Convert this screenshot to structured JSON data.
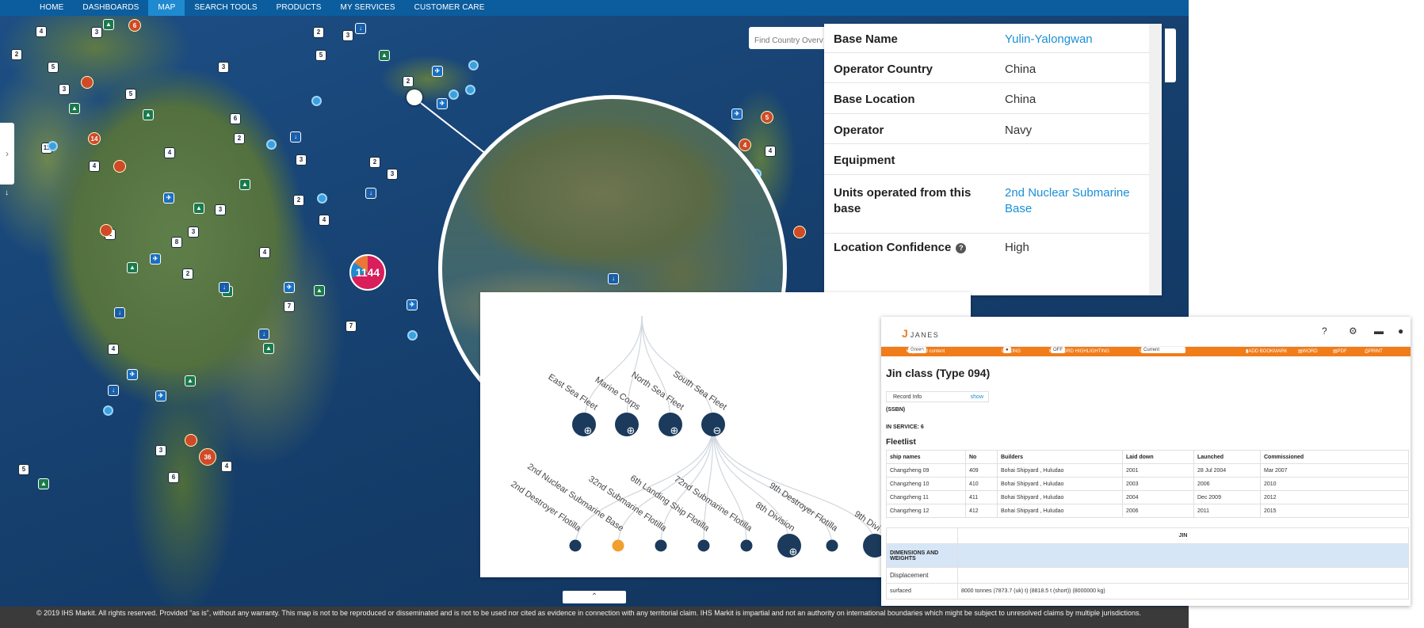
{
  "nav": {
    "items": [
      "HOME",
      "DASHBOARDS",
      "MAP",
      "SEARCH TOOLS",
      "PRODUCTS",
      "MY SERVICES",
      "CUSTOMER CARE"
    ],
    "active": "MAP"
  },
  "map": {
    "search_placeholder": "Find Country Overv",
    "cluster_label": "1144",
    "red_markers": [
      "6",
      "14",
      "5",
      "36",
      "4",
      "5"
    ],
    "number_markers": [
      "2",
      "3",
      "4",
      "5",
      "6",
      "7",
      "8",
      "11",
      "14"
    ],
    "footer": "© 2019 IHS Markit. All rights reserved. Provided “as is”, without any warranty. This map is not to be reproduced or disseminated and is not to be used nor cited as evidence in connection with any territorial claim. IHS Markit is impartial and not an authority on international boundaries which might be subject to unresolved claims by multiple jurisdictions."
  },
  "base_info": {
    "rows": [
      {
        "label": "Base Name",
        "value": "Yulin-Yalongwan",
        "link": true
      },
      {
        "label": "Operator Country",
        "value": "China",
        "link": false
      },
      {
        "label": "Base Location",
        "value": "China",
        "link": false
      },
      {
        "label": "Operator",
        "value": "Navy",
        "link": false
      },
      {
        "label": "Equipment",
        "value": "",
        "link": false
      },
      {
        "label": "Units operated from this base",
        "value": "2nd Nuclear Submarine Base",
        "link": true
      },
      {
        "label": "Location Confidence",
        "value": "High",
        "link": false
      }
    ],
    "help_icon": "?"
  },
  "org_tree": {
    "fleets": [
      "East Sea Fleet",
      "Marine Corps",
      "North Sea Fleet",
      "South Sea Fleet"
    ],
    "units": [
      "2nd Destroyer Flotilla",
      "2nd Nuclear Submarine Base",
      "32nd Submarine Flotilla",
      "6th Landing Ship Flotilla",
      "72nd Submarine Flotilla",
      "8th Division",
      "9th Destroyer Flotilla",
      "9th Divi"
    ],
    "highlight_unit": "2nd Nuclear Submarine Base",
    "accent_color": "#f0a030",
    "node_color": "#1b3a5c"
  },
  "doc": {
    "brand": "JANES",
    "toolbar": {
      "key_label": "Key:",
      "key_box": "Green",
      "updated": "= updated content",
      "linking": "LINKING",
      "keyword": "KEYWORD HIGHLIGHTING",
      "keyword_state": "OFF",
      "update_history": "UPDATE HISTORY",
      "history_value": "Current",
      "bookmark": "ADD BOOKMARK",
      "word": "WORD",
      "pdf": "PDF",
      "print": "PRINT"
    },
    "title": "Jin class (Type 094)",
    "record_info": "Record Info",
    "record_show": "show",
    "type_code": "(SSBN)",
    "in_service": "IN SERVICE: 6",
    "fleetlist_title": "Fleetlist",
    "fleet_headers": [
      "ship names",
      "No",
      "Builders",
      "Laid down",
      "Launched",
      "Commissioned"
    ],
    "fleet_rows": [
      [
        "Changzheng 09",
        "409",
        "Bohai Shipyard , Huludao",
        "2001",
        "28 Jul 2004",
        "Mar 2007"
      ],
      [
        "Changzheng 10",
        "410",
        "Bohai Shipyard , Huludao",
        "2003",
        "2006",
        "2010"
      ],
      [
        "Changzheng 11",
        "411",
        "Bohai Shipyard , Huludao",
        "2004",
        "Dec 2009",
        "2012"
      ],
      [
        "Changzheng 12",
        "412",
        "Bohai Shipyard , Huludao",
        "2006",
        "2011",
        "2015"
      ]
    ],
    "dims_header": "JIN",
    "dims_section": "DIMENSIONS AND WEIGHTS",
    "displacement": "Displacement",
    "surfaced_label": "surfaced",
    "surfaced_value": "8000 tonnes  (7873.7 (uk) t)  (8818.5 t (short))  (8000000 kg)"
  }
}
